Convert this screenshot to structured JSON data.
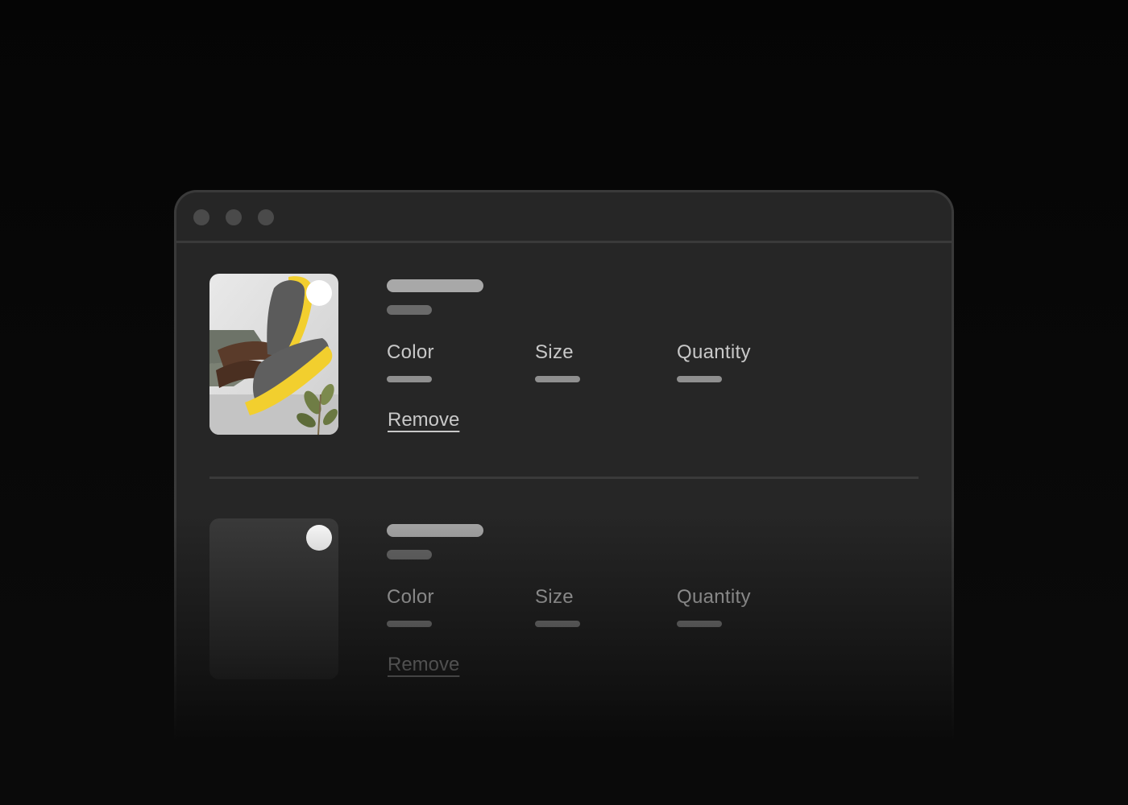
{
  "colors": {
    "background": "#0a0a0a",
    "window": "#262626",
    "border": "#3a3a3a",
    "text": "#c8c8c8",
    "accent_sole": "#f2cf2e"
  },
  "window": {
    "controls": [
      "window-dot-icon",
      "window-dot-icon",
      "window-dot-icon"
    ]
  },
  "cart": {
    "items": [
      {
        "image": "shoe-product-photo",
        "has_image": true,
        "color_label": "Color",
        "size_label": "Size",
        "quantity_label": "Quantity",
        "remove_label": "Remove"
      },
      {
        "image": "image-placeholder",
        "has_image": false,
        "color_label": "Color",
        "size_label": "Size",
        "quantity_label": "Quantity",
        "remove_label": "Remove"
      }
    ]
  }
}
